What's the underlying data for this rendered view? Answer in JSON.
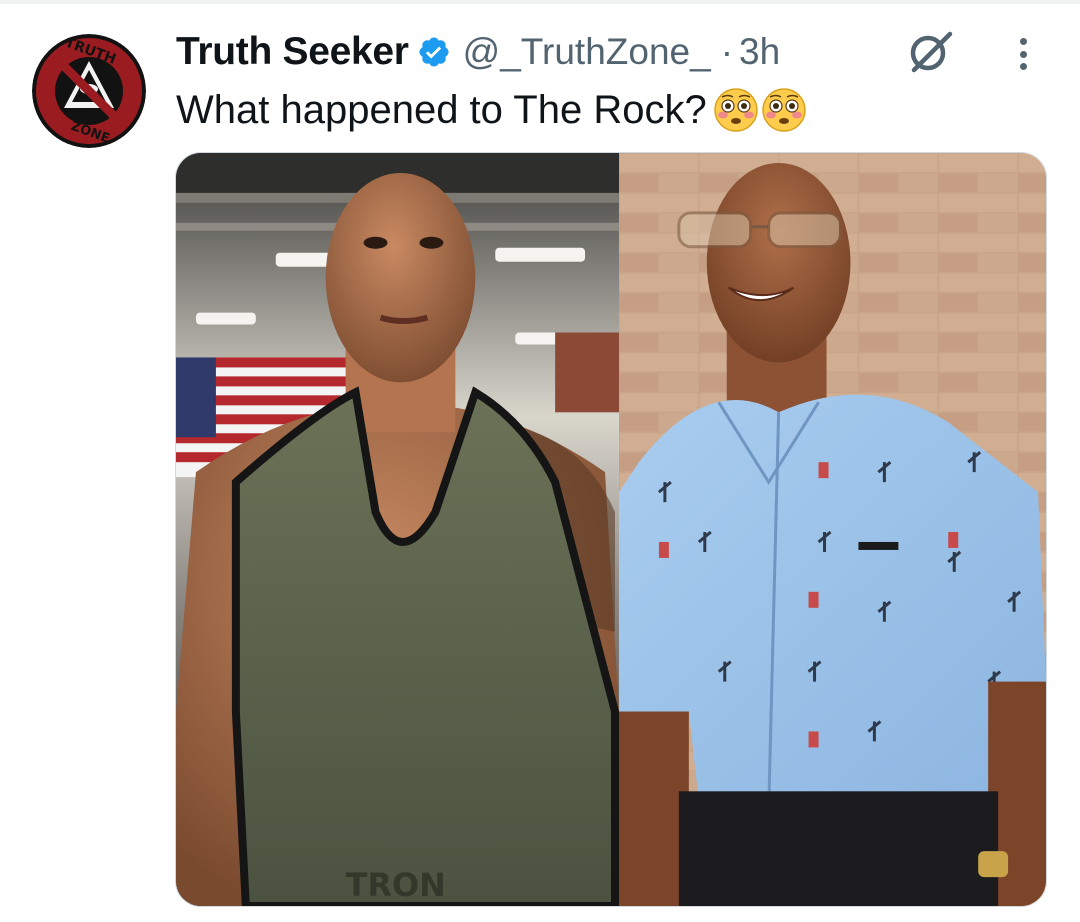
{
  "post": {
    "author": {
      "display_name": "Truth Seeker",
      "handle": "@_TruthZone_",
      "verified": true,
      "avatar_icon": "truth-zone-logo",
      "avatar_text_top": "TRUTH",
      "avatar_text_bottom": "ZONE"
    },
    "separator": "·",
    "timestamp": "3h",
    "text": "What happened to The Rock?",
    "emojis": [
      "flushed-face-emoji",
      "flushed-face-emoji"
    ],
    "actions": {
      "grok_icon": "grok-icon",
      "more_icon": "more-options-icon"
    },
    "media": {
      "images": [
        {
          "name": "photo-gym-tank-top",
          "shirt_text": "TRON"
        },
        {
          "name": "photo-blue-shirt"
        }
      ]
    }
  },
  "colors": {
    "text_primary": "#0f1419",
    "text_secondary": "#536471",
    "verified_blue": "#1d9bf0",
    "avatar_red": "#9b1c20",
    "border": "#cfd9de"
  }
}
